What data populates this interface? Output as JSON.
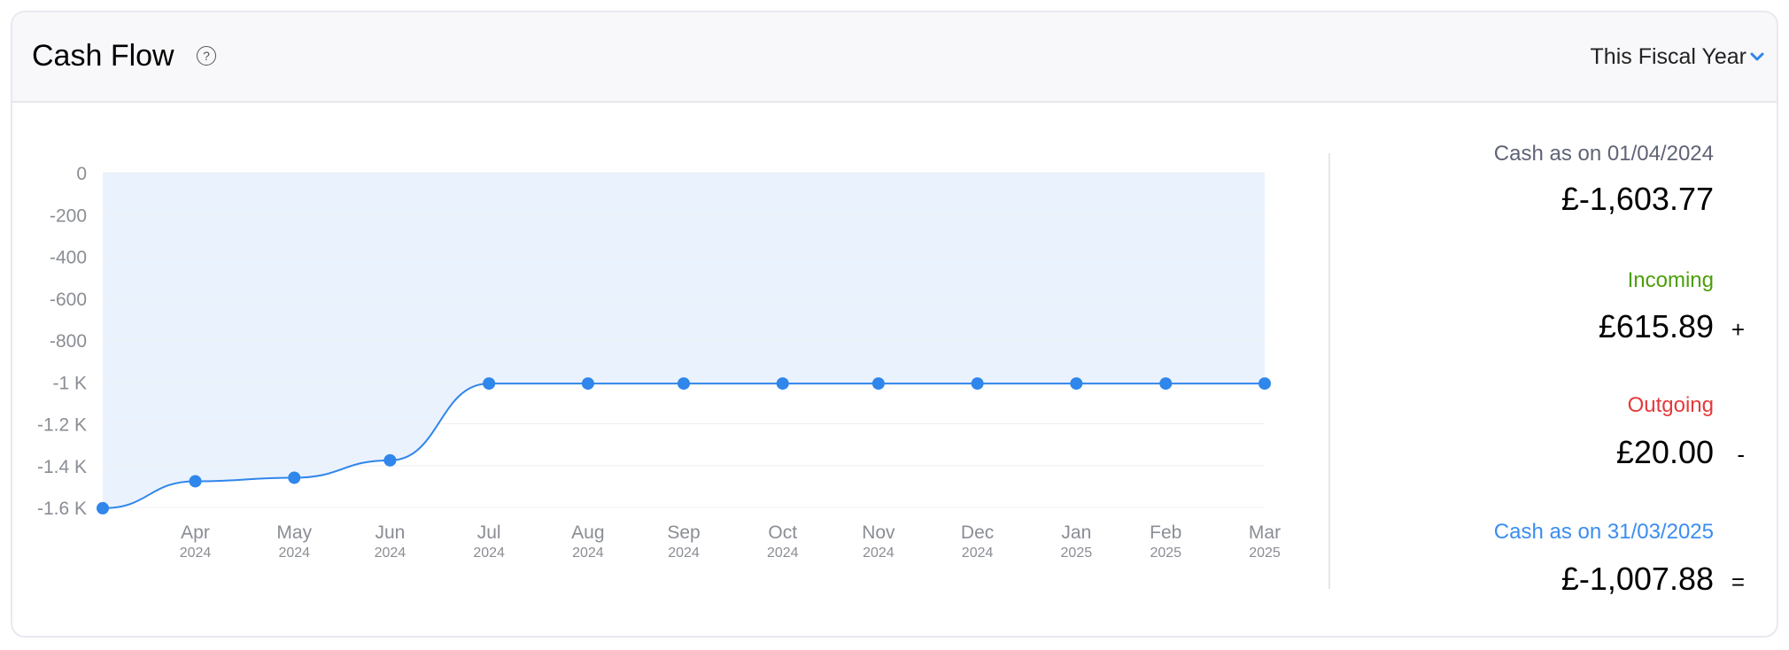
{
  "header": {
    "title": "Cash Flow",
    "help_icon": "question-circle-icon",
    "period": "This Fiscal Year"
  },
  "summary": {
    "opening_label": "Cash as on 01/04/2024",
    "opening_value": "£-1,603.77",
    "incoming_label": "Incoming",
    "incoming_value": "£615.89",
    "incoming_op": "+",
    "outgoing_label": "Outgoing",
    "outgoing_value": "£20.00",
    "outgoing_op": "-",
    "closing_label": "Cash as on 31/03/2025",
    "closing_value": "£-1,007.88",
    "closing_op": "="
  },
  "colors": {
    "accent": "#2f86eb",
    "fill": "#eaf2fd",
    "incoming": "#4c9e0a",
    "outgoing": "#e5393b",
    "closing_label": "#3b8df0",
    "opening_label": "#5f6475"
  },
  "chart_data": {
    "type": "area",
    "ylim": [
      -1600,
      0
    ],
    "yticks": [
      0,
      -200,
      -400,
      -600,
      -800,
      -1000,
      -1200,
      -1400,
      -1600
    ],
    "ytick_labels": [
      "0",
      "-200",
      "-400",
      "-600",
      "-800",
      "-1 K",
      "-1.2 K",
      "-1.4 K",
      "-1.6 K"
    ],
    "xlim": [
      "2024-04-01",
      "2025-03-31"
    ],
    "points": [
      {
        "date": "2024-04-01",
        "value": -1603.77
      },
      {
        "date": "2024-04-30",
        "value": -1475
      },
      {
        "date": "2024-05-31",
        "value": -1458
      },
      {
        "date": "2024-06-30",
        "value": -1375
      },
      {
        "date": "2024-07-31",
        "value": -1007.88
      },
      {
        "date": "2024-08-31",
        "value": -1007.88
      },
      {
        "date": "2024-09-30",
        "value": -1007.88
      },
      {
        "date": "2024-10-31",
        "value": -1007.88
      },
      {
        "date": "2024-11-30",
        "value": -1007.88
      },
      {
        "date": "2024-12-31",
        "value": -1007.88
      },
      {
        "date": "2025-01-31",
        "value": -1007.88
      },
      {
        "date": "2025-02-28",
        "value": -1007.88
      },
      {
        "date": "2025-03-31",
        "value": -1007.88
      }
    ],
    "xtick_labels": [
      {
        "month": "Apr",
        "year": "2024"
      },
      {
        "month": "May",
        "year": "2024"
      },
      {
        "month": "Jun",
        "year": "2024"
      },
      {
        "month": "Jul",
        "year": "2024"
      },
      {
        "month": "Aug",
        "year": "2024"
      },
      {
        "month": "Sep",
        "year": "2024"
      },
      {
        "month": "Oct",
        "year": "2024"
      },
      {
        "month": "Nov",
        "year": "2024"
      },
      {
        "month": "Dec",
        "year": "2024"
      },
      {
        "month": "Jan",
        "year": "2025"
      },
      {
        "month": "Feb",
        "year": "2025"
      },
      {
        "month": "Mar",
        "year": "2025"
      }
    ],
    "grid": true
  }
}
